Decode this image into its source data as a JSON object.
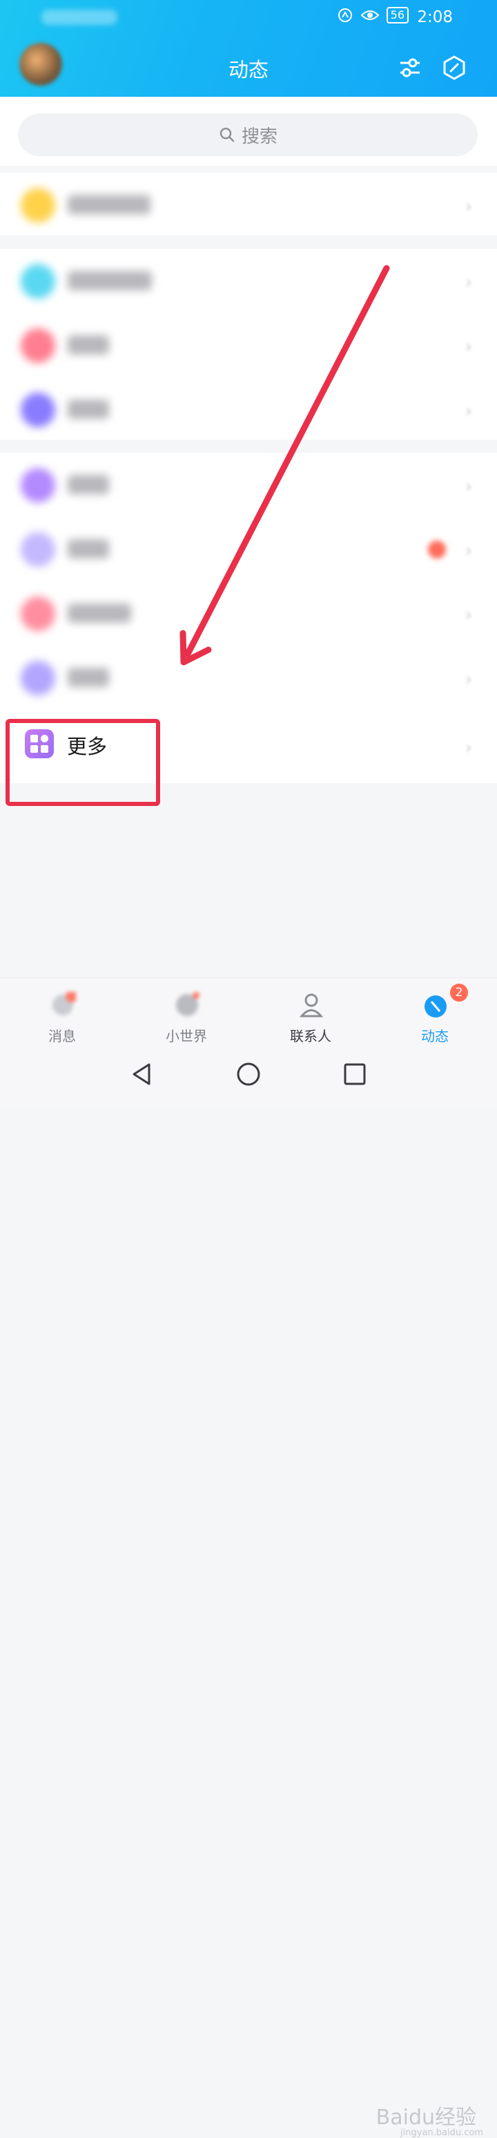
{
  "status_bar": {
    "battery": "56",
    "time": "2:08"
  },
  "header": {
    "title": "动态"
  },
  "search": {
    "placeholder": "搜索"
  },
  "list": {
    "more_label": "更多"
  },
  "tab_bar": {
    "tabs": [
      {
        "label": "消息",
        "active": false
      },
      {
        "label": "小世界",
        "active": false
      },
      {
        "label": "联系人",
        "active": false
      },
      {
        "label": "动态",
        "active": true,
        "badge": "2"
      }
    ]
  },
  "watermark": {
    "brand": "Baidu经验",
    "url": "jingyan.baidu.com"
  },
  "colors": {
    "header_start": "#1cc6f2",
    "header_end": "#12a6f7",
    "accent": "#1a9cf5",
    "annotation_red": "#e8304a",
    "more_icon": "#b577f3"
  }
}
